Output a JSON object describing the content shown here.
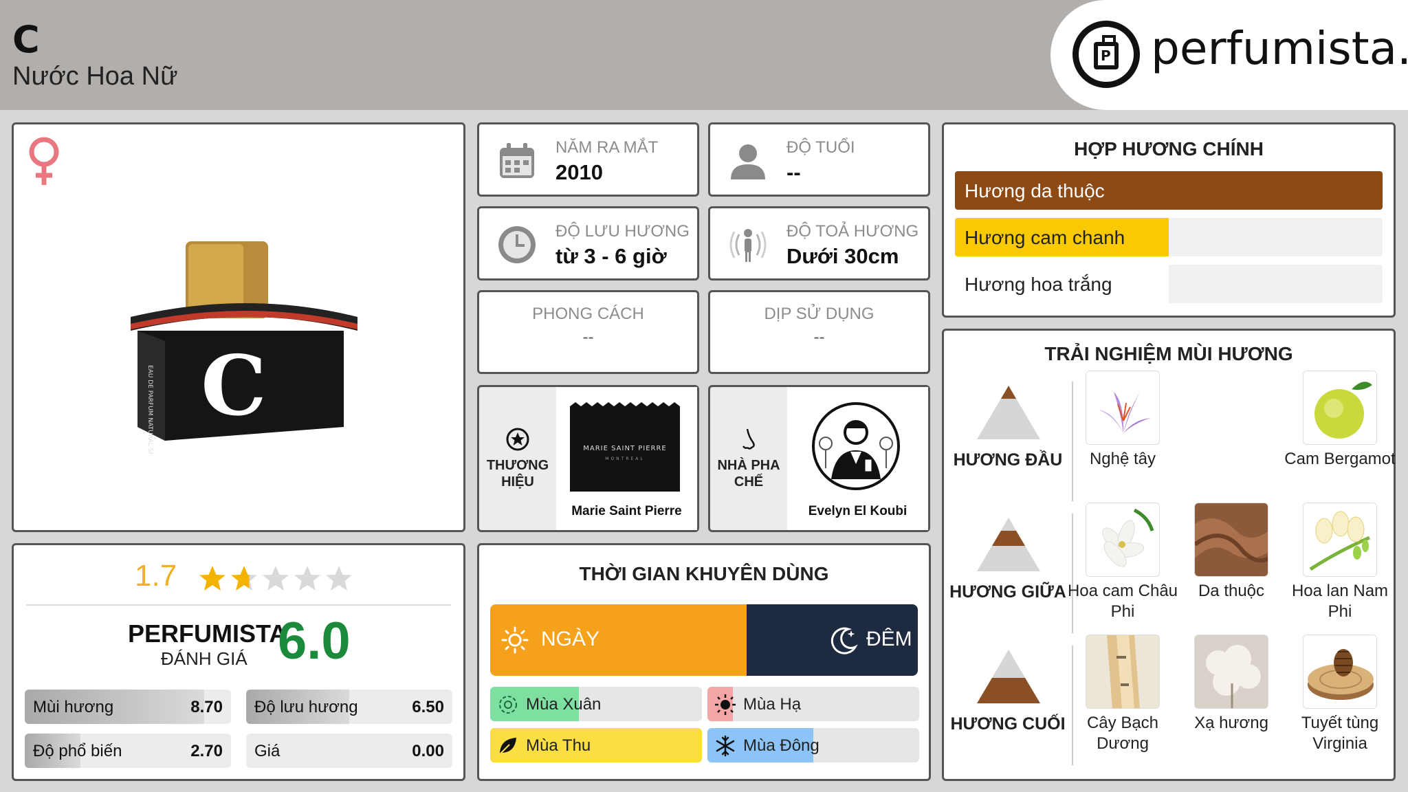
{
  "header": {
    "title": "C",
    "subtitle": "Nước Hoa Nữ",
    "logo_text": "perfumista.vn"
  },
  "product": {
    "gender_icon": "female-icon",
    "bottle_letter": "C",
    "box_label": "EAU DE PARFUM NATURAL SPRAY"
  },
  "info": {
    "release": {
      "label": "NĂM RA MẮT",
      "value": "2010",
      "icon": "calendar-icon"
    },
    "age": {
      "label": "ĐỘ TUỔI",
      "value": "--",
      "icon": "person-icon"
    },
    "longevity": {
      "label": "ĐỘ LƯU HƯƠNG",
      "value": "từ 3 - 6 giờ",
      "icon": "clock-icon"
    },
    "sillage": {
      "label": "ĐỘ TOẢ HƯƠNG",
      "value": "Dưới 30cm",
      "icon": "sillage-icon"
    },
    "style": {
      "label": "PHONG CÁCH",
      "value": "--"
    },
    "occasion": {
      "label": "DỊP SỬ DỤNG",
      "value": "--"
    }
  },
  "brand": {
    "label_line1": "THƯƠNG",
    "label_line2": "HIỆU",
    "name": "Marie Saint Pierre",
    "logo_text": "MARIE SAINT PIERRE",
    "logo_sub": "MONTREAL"
  },
  "perfumer": {
    "label_line1": "NHÀ PHA",
    "label_line2": "CHẾ",
    "name": "Evelyn El Koubi"
  },
  "rating": {
    "score": "1.7",
    "stars": 1.7,
    "stars_max": 5,
    "perfumista_label": "PERFUMISTA",
    "perfumista_sub": "ĐÁNH GIÁ",
    "perfumista_score": "6.0",
    "stats": [
      {
        "name": "Mùi hương",
        "value": "8.70",
        "fraction": 0.87
      },
      {
        "name": "Độ lưu hương",
        "value": "6.50",
        "fraction": 0.5
      },
      {
        "name": "Độ phổ biến",
        "value": "2.70",
        "fraction": 0.27
      },
      {
        "name": "Giá",
        "value": "0.00",
        "fraction": 0
      }
    ]
  },
  "time": {
    "title": "THỜI GIAN KHUYÊN DÙNG",
    "day": "NGÀY",
    "night": "ĐÊM",
    "day_fraction": 0.6,
    "seasons": [
      {
        "name": "Mùa Xuân",
        "fraction": 0.42,
        "color": "#7ee0a0",
        "icon": "flower-icon"
      },
      {
        "name": "Mùa Hạ",
        "fraction": 0.12,
        "color": "#f4a6a6",
        "icon": "sun-icon"
      },
      {
        "name": "Mùa Thu",
        "fraction": 1.0,
        "color": "#fbdf42",
        "icon": "leaf-icon"
      },
      {
        "name": "Mùa Đông",
        "fraction": 0.5,
        "color": "#8cc4f7",
        "icon": "snowflake-icon"
      }
    ]
  },
  "accords": {
    "title": "HỢP HƯƠNG CHÍNH",
    "items": [
      {
        "name": "Hương da thuộc",
        "fraction": 1.0,
        "color": "#8d4a14",
        "text_color": "#ffffff"
      },
      {
        "name": "Hương cam chanh",
        "fraction": 0.5,
        "color": "#f9c902",
        "text_color": "#222222"
      },
      {
        "name": "Hương hoa trắng",
        "fraction": 0.5,
        "color": "#ffffff",
        "text_color": "#222222"
      }
    ]
  },
  "experience": {
    "title": "TRẢI NGHIỆM MÙI HƯƠNG",
    "tiers": [
      {
        "label": "HƯƠNG ĐẦU",
        "notes": [
          {
            "name": "Nghệ tây",
            "slot": 0,
            "icon": "saffron-icon"
          },
          {
            "name": "Cam Bergamot",
            "slot": 2,
            "icon": "bergamot-icon"
          }
        ]
      },
      {
        "label": "HƯƠNG GIỮA",
        "notes": [
          {
            "name": "Hoa cam Châu Phi",
            "slot": 0,
            "icon": "orange-blossom-icon"
          },
          {
            "name": "Da thuộc",
            "slot": 1,
            "icon": "leather-icon"
          },
          {
            "name": "Hoa lan Nam Phi",
            "slot": 2,
            "icon": "freesia-icon"
          }
        ]
      },
      {
        "label": "HƯƠNG CUỐI",
        "notes": [
          {
            "name": "Cây Bạch Dương",
            "slot": 0,
            "icon": "birch-icon"
          },
          {
            "name": "Xạ hương",
            "slot": 1,
            "icon": "musk-icon"
          },
          {
            "name": "Tuyết tùng Virginia",
            "slot": 2,
            "icon": "cedar-icon"
          }
        ]
      }
    ]
  }
}
